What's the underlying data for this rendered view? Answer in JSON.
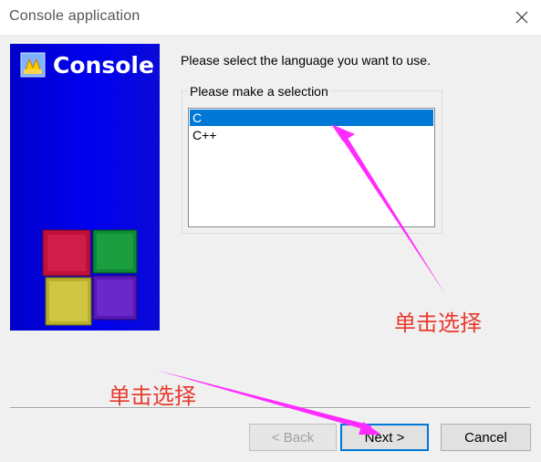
{
  "window": {
    "title": "Console application",
    "close_icon": "close-icon"
  },
  "banner": {
    "title": "Console",
    "logo_icon": "codeblocks-logo-icon",
    "background": "#0000e6"
  },
  "main": {
    "prompt": "Please select the language you want to use.",
    "group_label": "Please make a selection",
    "languages": [
      "C",
      "C++"
    ],
    "selected": "C"
  },
  "buttons": {
    "back": "< Back",
    "next": "Next >",
    "cancel": "Cancel"
  },
  "annotations": {
    "list_hint": "单击选择",
    "next_hint": "单击选择",
    "arrow_color": "#ff2bff",
    "text_color": "#e83a2e"
  }
}
